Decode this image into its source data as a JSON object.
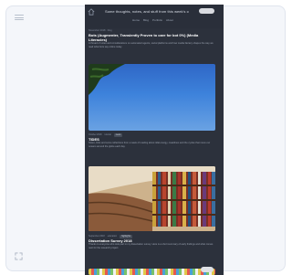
{
  "page": {
    "site_title": "Some thoughts, notes, and stuff from this week's creator",
    "nav": [
      "Home",
      "Blog",
      "Portfolio",
      "About"
    ]
  },
  "posts": [
    {
      "meta": "November 2018 · blog",
      "title": "Bots (Augmenter, Transiently Proven to care for bot 0%) (Media Literacies)",
      "excerpt": "A thread of notes and considerations on automated agents, social platforms and how media literacy shapes the way we read what bots say online today."
    },
    {
      "tags": [
        "October 2018",
        "tutorial",
        "news"
      ],
      "title": "TIDES",
      "excerpt": "Notes, links and some reflections from a week of reading about tidal energy, coastlines and the cycles that move our oceans around the globe each day."
    },
    {
      "tags": [
        "September 2018",
        "education",
        "highlights"
      ],
      "title": "Dissertation Survey 2018",
      "excerpt": "Thanks to everyone who took part in my dissertation survey. Here is a short summary of early findings and what comes next for the research project."
    }
  ],
  "colors": {
    "background": "#2c313c",
    "title": "#ffffff",
    "muted": "#9ba3b1"
  },
  "icons": [
    "hamburger-menu-icon",
    "home-icon",
    "expand-icon"
  ]
}
